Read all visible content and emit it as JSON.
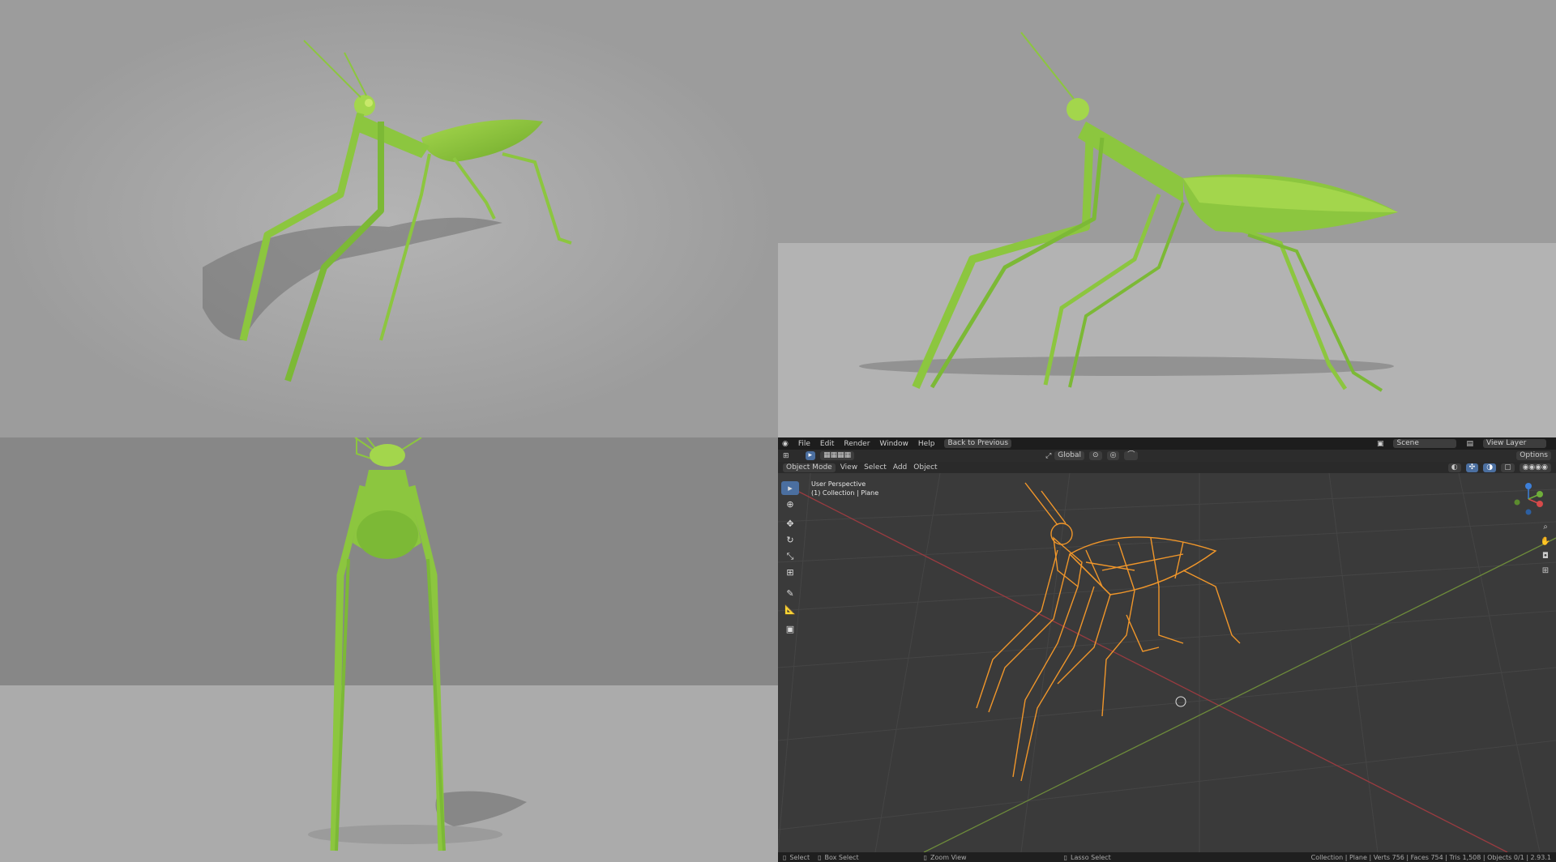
{
  "blender": {
    "menu": [
      "File",
      "Edit",
      "Render",
      "Window",
      "Help"
    ],
    "back_button": "Back to Previous",
    "scene_label": "Scene",
    "view_layer_label": "View Layer",
    "transform_orientation": "Global",
    "mode": "Object Mode",
    "view_menu": [
      "View",
      "Select",
      "Add",
      "Object"
    ],
    "options_label": "Options",
    "viewport_title": "User Perspective",
    "viewport_sub": "(1) Collection | Plane",
    "status": {
      "select": "Select",
      "box_select": "Box Select",
      "zoom_view": "Zoom View",
      "lasso_select": "Lasso Select",
      "stats": "Collection | Plane | Verts 756 | Faces 754 | Tris 1,508 | Objects 0/1 | 2.93.1"
    },
    "colors": {
      "wire": "#f0962a",
      "bg": "#3a3a3a",
      "accent": "#4b6fa0"
    }
  },
  "renders": {
    "mantis_color": "#8cc63f",
    "icons": [
      "mantis-render-three-quarter",
      "mantis-render-side",
      "mantis-render-front"
    ]
  }
}
